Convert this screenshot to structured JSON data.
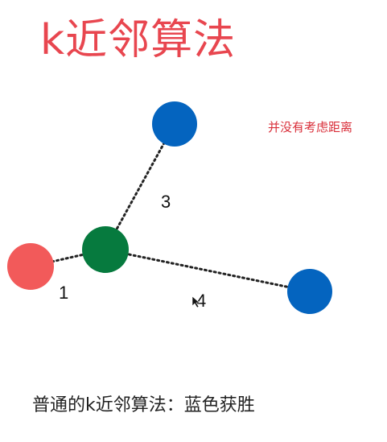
{
  "title": "k近邻算法",
  "note": "并没有考虑距离",
  "caption": "普通的k近邻算法：蓝色获胜",
  "edges": {
    "to_top_blue": "3",
    "to_red": "1",
    "to_right_blue": "4"
  },
  "colors": {
    "query_node": "#067a3e",
    "red_node": "#f25a5a",
    "blue_node": "#0464bf",
    "title": "#e8464f",
    "note": "#d92f3a"
  }
}
